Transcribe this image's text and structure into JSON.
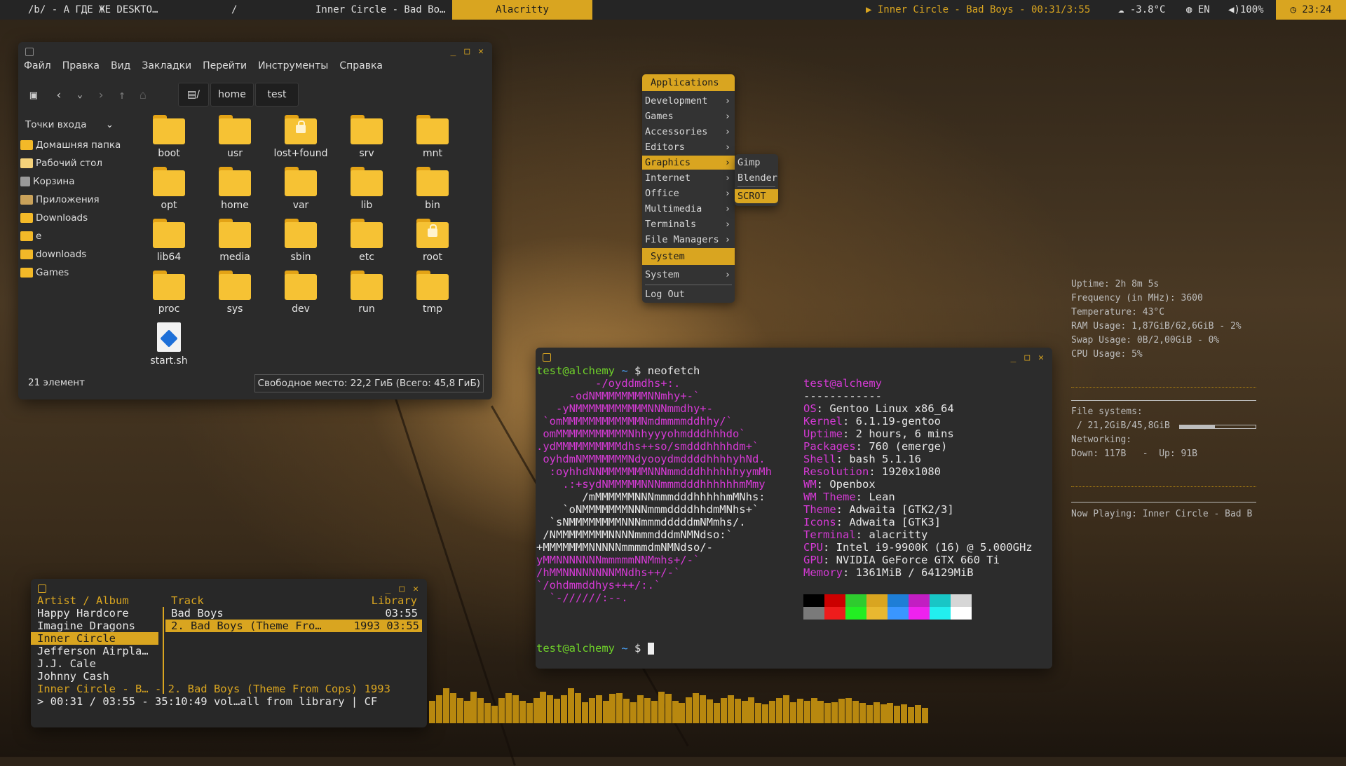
{
  "topbar": {
    "title": "/b/ - А ГДЕ ЖЕ DESKTO…",
    "sep": "/",
    "win2": "Inner Circle - Bad Bo…",
    "active": "Alacritty",
    "now_playing": "Inner Circle - Bad Boys - 00:31/3:55",
    "weather": "-3.8°C",
    "lang": "EN",
    "volume": "100%",
    "clock": "23:24"
  },
  "filemanager": {
    "menu": [
      "Файл",
      "Правка",
      "Вид",
      "Закладки",
      "Перейти",
      "Инструменты",
      "Справка"
    ],
    "breadcrumbs": [
      "/",
      "home",
      "test"
    ],
    "sidebar_header": "Точки входа",
    "sidebar": [
      "Домашняя папка",
      "Рабочий стол",
      "Корзина",
      "Приложения",
      "Downloads",
      "e",
      "downloads",
      "Games"
    ],
    "items": [
      {
        "name": "boot",
        "lock": false
      },
      {
        "name": "usr",
        "lock": false
      },
      {
        "name": "lost+found",
        "lock": true
      },
      {
        "name": "srv",
        "lock": false
      },
      {
        "name": "mnt",
        "lock": false
      },
      {
        "name": "opt",
        "lock": false
      },
      {
        "name": "home",
        "lock": false
      },
      {
        "name": "var",
        "lock": false
      },
      {
        "name": "lib",
        "lock": false
      },
      {
        "name": "bin",
        "lock": false
      },
      {
        "name": "lib64",
        "lock": false
      },
      {
        "name": "media",
        "lock": false
      },
      {
        "name": "sbin",
        "lock": false
      },
      {
        "name": "etc",
        "lock": false
      },
      {
        "name": "root",
        "lock": true
      },
      {
        "name": "proc",
        "lock": false
      },
      {
        "name": "sys",
        "lock": false
      },
      {
        "name": "dev",
        "lock": false
      },
      {
        "name": "run",
        "lock": false
      },
      {
        "name": "tmp",
        "lock": false
      },
      {
        "name": "start.sh",
        "file": true
      }
    ],
    "status": "21 элемент",
    "free": "Свободное место: 22,2 ГиБ (Всего: 45,8 ГиБ)"
  },
  "menu": {
    "header": "Applications",
    "items": [
      "Development",
      "Games",
      "Accessories",
      "Editors",
      "Graphics",
      "Internet",
      "Office",
      "Multimedia",
      "Terminals",
      "File Managers"
    ],
    "section": "System",
    "system": "System",
    "logout": "Log Out",
    "submenu": [
      "Gimp",
      "Blender",
      "SCROT"
    ]
  },
  "terminal": {
    "prompt_user": "test@alchemy",
    "prompt_tilde": "~",
    "prompt_dollar": "$",
    "command": "neofetch",
    "logo": [
      "         -/oyddmdhs+:.",
      "     -odNMMMMMMMMNNmhy+-`",
      "   -yNMMMMMMMMMMMNNNmmdhy+-",
      " `omMMMMMMMMMMMMNmdmmmmddhhy/`",
      " omMMMMMMMMMMMNhhyyyohmdddhhhdo`",
      ".ydMMMMMMMMMMdhs++so/smdddhhhhdm+`",
      " oyhdmNMMMMMMMNdyooydmddddhhhhyhNd.",
      "  :oyhhdNNMMMMMMMNNNmmdddhhhhhhyymMh",
      "    .:+sydNMMMMMNNNmmmdddhhhhhhmMmy",
      "       /mMMMMMMNNNmmmdddhhhhhmMNhs:",
      "    `oNMMMMMMMNNNmmmddddhhdmMNhs+`",
      "  `sNMMMMMMMMNNNmmmdddddmNMmhs/.",
      " /NMMMMMMMMNNNNmmmdddmNMNdso:`",
      "+MMMMMMMNNNNNmmmmdmNMNdso/-",
      "yMMNNNNNNNmmmmmNNMmhs+/-`",
      "/hMMNNNNNNNNMNdhs++/-`",
      "`/ohdmmddhys+++/:.`",
      "  `-//////:--."
    ],
    "info_user": "test@alchemy",
    "info_sep": "------------",
    "info": [
      {
        "k": "OS",
        "v": "Gentoo Linux x86_64"
      },
      {
        "k": "Kernel",
        "v": "6.1.19-gentoo"
      },
      {
        "k": "Uptime",
        "v": "2 hours, 6 mins"
      },
      {
        "k": "Packages",
        "v": "760 (emerge)"
      },
      {
        "k": "Shell",
        "v": "bash 5.1.16"
      },
      {
        "k": "Resolution",
        "v": "1920x1080"
      },
      {
        "k": "WM",
        "v": "Openbox"
      },
      {
        "k": "WM Theme",
        "v": "Lean"
      },
      {
        "k": "Theme",
        "v": "Adwaita [GTK2/3]"
      },
      {
        "k": "Icons",
        "v": "Adwaita [GTK3]"
      },
      {
        "k": "Terminal",
        "v": "alacritty"
      },
      {
        "k": "CPU",
        "v": "Intel i9-9900K (16) @ 5.000GHz"
      },
      {
        "k": "GPU",
        "v": "NVIDIA GeForce GTX 660 Ti"
      },
      {
        "k": "Memory",
        "v": "1361MiB / 64129MiB"
      }
    ],
    "palette_top": [
      "#000000",
      "#cc0000",
      "#2ecc2e",
      "#d9a520",
      "#1e7ed6",
      "#c21ec2",
      "#18c6c6",
      "#d6d6d6"
    ],
    "palette_bottom": [
      "#7a7a7a",
      "#ee1c1c",
      "#22ee22",
      "#e8b830",
      "#3a96ff",
      "#ee22ee",
      "#22eeee",
      "#ffffff"
    ]
  },
  "cmus": {
    "col1": "Artist / Album",
    "col2": "Track",
    "col3": "Library",
    "artists": [
      "Happy Hardcore",
      "Imagine Dragons",
      "Inner Circle",
      "Jefferson Airpla…",
      "J.J. Cale",
      "Johnny Cash"
    ],
    "album": "Bad Boys",
    "album_time": "03:55",
    "track": "2. Bad Boys (Theme Fro…",
    "track_year": "1993",
    "track_time": "03:55",
    "status1": "Inner Circle - B… - 2. Bad Boys (Theme From Cops) 1993",
    "status2": "> 00:31 / 03:55 - 35:10:49 vol…all from library | CF"
  },
  "conky": {
    "uptime": "Uptime: 2h 8m 5s",
    "freq": "Frequency (in MHz): 3600",
    "temp": "Temperature: 43°C",
    "ram": "RAM Usage: 1,87GiB/62,6GiB - 2%",
    "swap": "Swap Usage: 0B/2,00GiB - 0%",
    "cpu": "CPU Usage: 5%",
    "fs_label": "File systems:",
    "fs": " / 21,2GiB/45,8GiB",
    "fs_fraction": 0.46,
    "net_label": "Networking:",
    "net": "Down: 117B   -  Up: 91B",
    "now_playing": "Now Playing: Inner Circle - Bad B"
  },
  "visualizer_levels": [
    0.45,
    0.55,
    0.7,
    0.6,
    0.5,
    0.45,
    0.62,
    0.5,
    0.4,
    0.35,
    0.5,
    0.6,
    0.55,
    0.45,
    0.4,
    0.5,
    0.62,
    0.55,
    0.48,
    0.55,
    0.7,
    0.6,
    0.42,
    0.5,
    0.55,
    0.45,
    0.58,
    0.6,
    0.48,
    0.42,
    0.55,
    0.5,
    0.45,
    0.62,
    0.58,
    0.45,
    0.4,
    0.52,
    0.6,
    0.55,
    0.47,
    0.4,
    0.5,
    0.56,
    0.48,
    0.45,
    0.52,
    0.4,
    0.38,
    0.45,
    0.5,
    0.55,
    0.42,
    0.48,
    0.45,
    0.5,
    0.44,
    0.4,
    0.42,
    0.48,
    0.5,
    0.45,
    0.4,
    0.36,
    0.42,
    0.38,
    0.4,
    0.35,
    0.38,
    0.32,
    0.36,
    0.3
  ]
}
